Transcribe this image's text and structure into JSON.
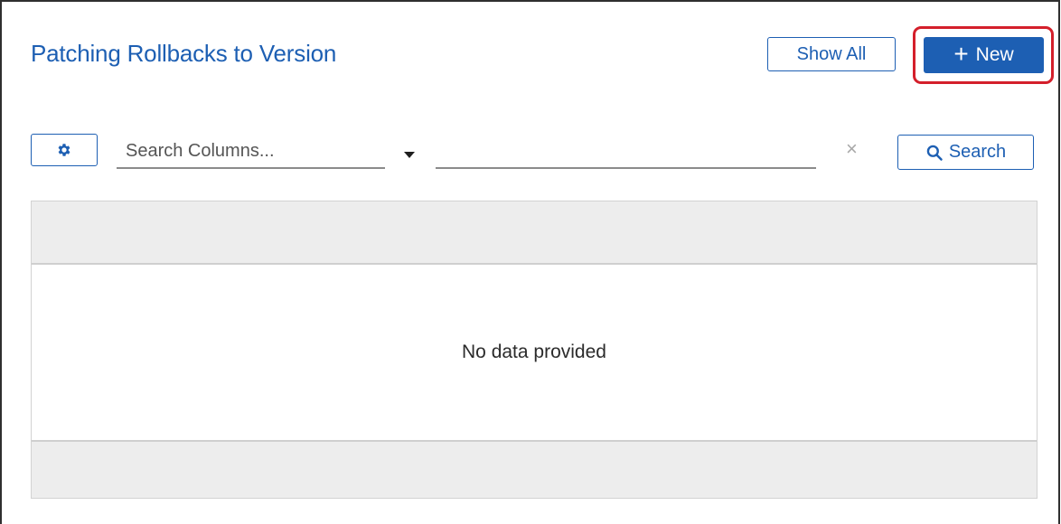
{
  "header": {
    "title": "Patching Rollbacks to Version",
    "show_all_label": "Show All",
    "new_label": "New",
    "new_icon": "plus-icon"
  },
  "toolbar": {
    "settings_icon": "gear-icon",
    "search_columns_placeholder": "Search Columns...",
    "dropdown_icon": "caret-down-icon",
    "search_value": "",
    "clear_icon": "close-icon",
    "search_label": "Search",
    "search_icon": "magnifier-icon"
  },
  "grid": {
    "empty_message": "No data provided"
  },
  "colors": {
    "accent": "#1d5fb3",
    "highlight": "#d41f2b",
    "grid_band": "#ededed"
  }
}
